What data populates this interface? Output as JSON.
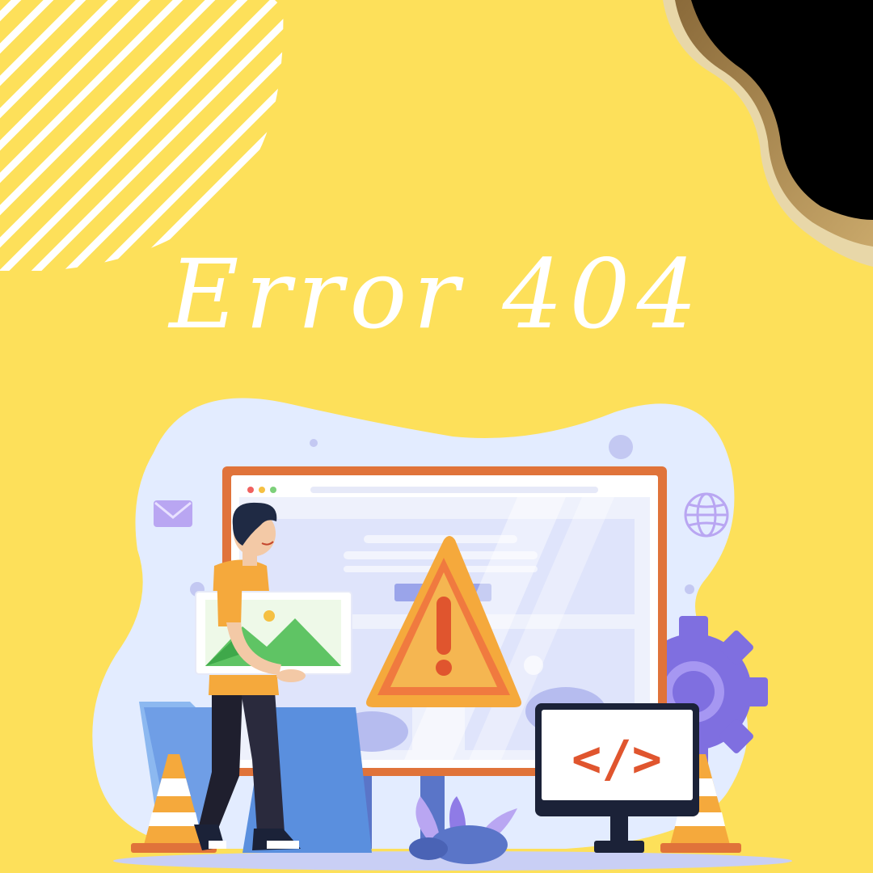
{
  "page": {
    "title": "Error 404",
    "background_color": "#fde05a"
  },
  "illustration": {
    "code_monitor_text": "</>",
    "icons": [
      "mail-icon",
      "globe-icon",
      "gear-icon",
      "warning-icon",
      "traffic-cone-icon",
      "image-icon",
      "plant-icon"
    ],
    "colors": {
      "blob": "#e3ecff",
      "frame": "#e0733a",
      "warning": "#f5a93c",
      "gear": "#8a7be8",
      "code": "#e0552e"
    }
  }
}
